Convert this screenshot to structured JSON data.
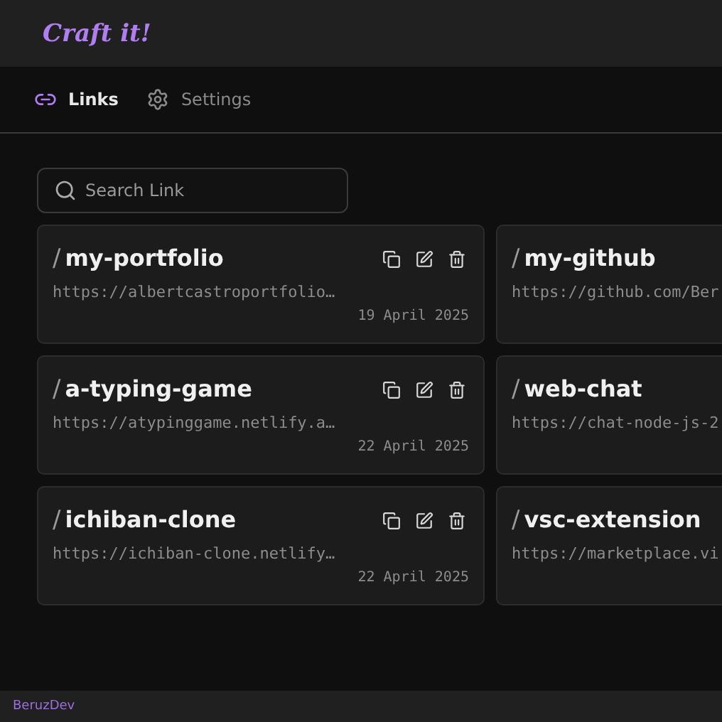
{
  "header": {
    "logo": "Craft it!"
  },
  "tabs": [
    {
      "label": "Links",
      "selected": true
    },
    {
      "label": "Settings",
      "selected": false
    }
  ],
  "search": {
    "placeholder": "Search Link"
  },
  "links": [
    {
      "slash": "/",
      "name": "my-portfolio",
      "url": "https://albertcastroportfolio…",
      "date": "19 April 2025"
    },
    {
      "slash": "/",
      "name": "my-github",
      "url": "https://github.com/Ber"
    },
    {
      "slash": "/",
      "name": "a-typing-game",
      "url": "https://atypinggame.netlify.a…",
      "date": "22 April 2025"
    },
    {
      "slash": "/",
      "name": "web-chat",
      "url": "https://chat-node-js-2"
    },
    {
      "slash": "/",
      "name": "ichiban-clone",
      "url": "https://ichiban-clone.netlify…",
      "date": "22 April 2025"
    },
    {
      "slash": "/",
      "name": "vsc-extension",
      "url": "https://marketplace.vi"
    }
  ],
  "footer": {
    "text": "BeruzDev"
  }
}
